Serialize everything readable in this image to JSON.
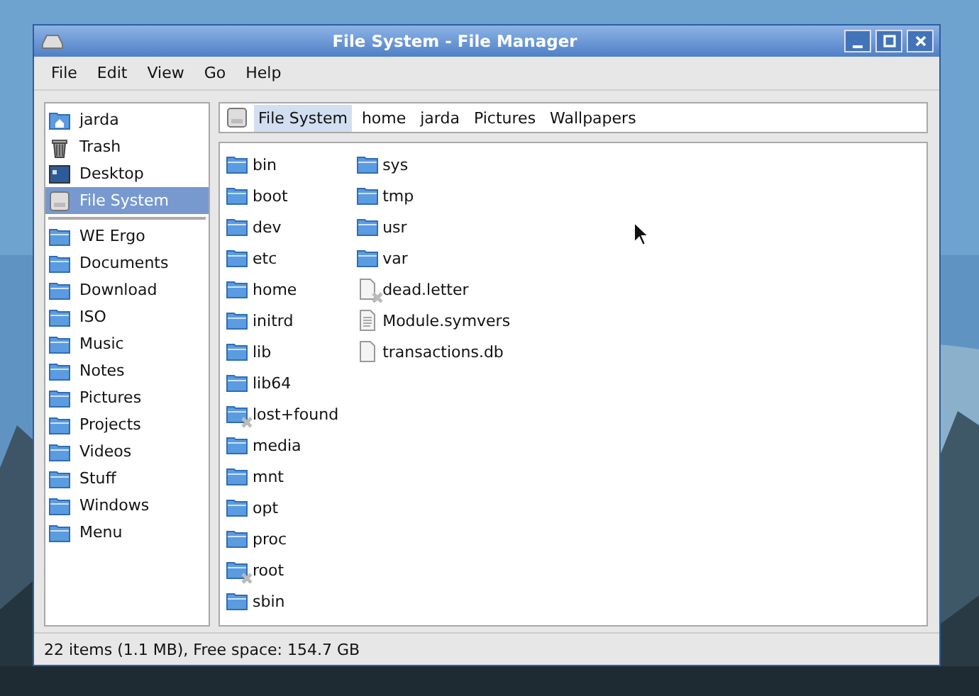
{
  "window": {
    "title": "File System - File Manager"
  },
  "menu": [
    "File",
    "Edit",
    "View",
    "Go",
    "Help"
  ],
  "sidebar": {
    "places": [
      {
        "label": "jarda",
        "kind": "home",
        "selected": false
      },
      {
        "label": "Trash",
        "kind": "trash",
        "selected": false
      },
      {
        "label": "Desktop",
        "kind": "desktop",
        "selected": false
      },
      {
        "label": "File System",
        "kind": "drive",
        "selected": true
      }
    ],
    "bookmarks": [
      {
        "label": "WE Ergo",
        "kind": "folder",
        "selected": false
      },
      {
        "label": "Documents",
        "kind": "folder",
        "selected": false
      },
      {
        "label": "Download",
        "kind": "folder",
        "selected": false
      },
      {
        "label": "ISO",
        "kind": "folder",
        "selected": false
      },
      {
        "label": "Music",
        "kind": "folder",
        "selected": false
      },
      {
        "label": "Notes",
        "kind": "folder",
        "selected": false
      },
      {
        "label": "Pictures",
        "kind": "folder",
        "selected": false
      },
      {
        "label": "Projects",
        "kind": "folder",
        "selected": false
      },
      {
        "label": "Videos",
        "kind": "folder",
        "selected": false
      },
      {
        "label": "Stuff",
        "kind": "folder",
        "selected": false
      },
      {
        "label": "Windows",
        "kind": "folder",
        "selected": false
      },
      {
        "label": "Menu",
        "kind": "folder",
        "selected": false
      }
    ]
  },
  "path_bar": [
    {
      "label": "File System",
      "selected": true
    },
    {
      "label": "home",
      "selected": false
    },
    {
      "label": "jarda",
      "selected": false
    },
    {
      "label": "Pictures",
      "selected": false
    },
    {
      "label": "Wallpapers",
      "selected": false
    }
  ],
  "files": [
    {
      "name": "bin",
      "kind": "folder",
      "unreadable": false
    },
    {
      "name": "boot",
      "kind": "folder",
      "unreadable": false
    },
    {
      "name": "dev",
      "kind": "folder",
      "unreadable": false
    },
    {
      "name": "etc",
      "kind": "folder",
      "unreadable": false
    },
    {
      "name": "home",
      "kind": "folder",
      "unreadable": false
    },
    {
      "name": "initrd",
      "kind": "folder",
      "unreadable": false
    },
    {
      "name": "lib",
      "kind": "folder",
      "unreadable": false
    },
    {
      "name": "lib64",
      "kind": "folder",
      "unreadable": false
    },
    {
      "name": "lost+found",
      "kind": "folder",
      "unreadable": true
    },
    {
      "name": "media",
      "kind": "folder",
      "unreadable": false
    },
    {
      "name": "mnt",
      "kind": "folder",
      "unreadable": false
    },
    {
      "name": "opt",
      "kind": "folder",
      "unreadable": false
    },
    {
      "name": "proc",
      "kind": "folder",
      "unreadable": false
    },
    {
      "name": "root",
      "kind": "folder",
      "unreadable": true
    },
    {
      "name": "sbin",
      "kind": "folder",
      "unreadable": false
    },
    {
      "name": "sys",
      "kind": "folder",
      "unreadable": false
    },
    {
      "name": "tmp",
      "kind": "folder",
      "unreadable": false
    },
    {
      "name": "usr",
      "kind": "folder",
      "unreadable": false
    },
    {
      "name": "var",
      "kind": "folder",
      "unreadable": false
    },
    {
      "name": "dead.letter",
      "kind": "file",
      "unreadable": true
    },
    {
      "name": "Module.symvers",
      "kind": "text",
      "unreadable": false
    },
    {
      "name": "transactions.db",
      "kind": "file",
      "unreadable": false
    }
  ],
  "status_bar": "22 items (1.1 MB), Free space: 154.7 GB"
}
